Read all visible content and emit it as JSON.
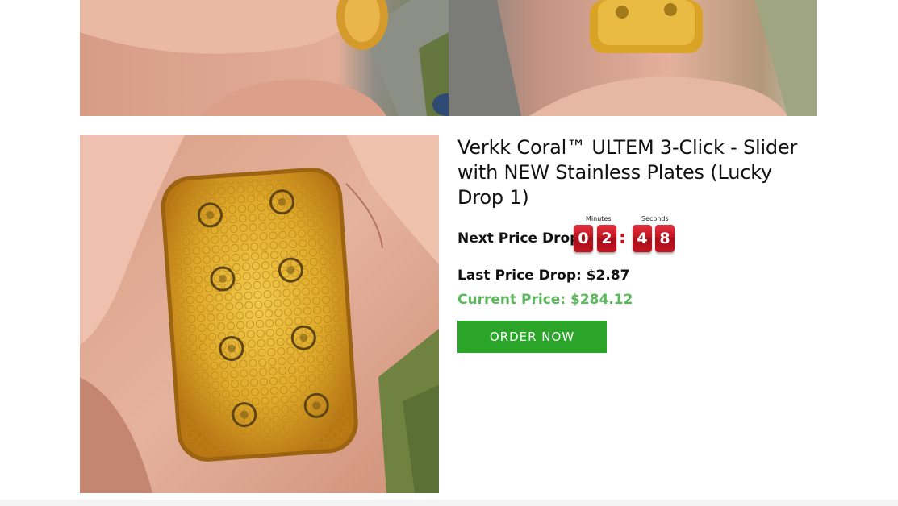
{
  "product": {
    "title": "Verkk Coral™ ULTEM 3-Click - Slider with NEW Stainless Plates (Lucky Drop 1)",
    "next_price_drop_label": "Next Price Drop:",
    "countdown": {
      "minutes_label": "Minutes",
      "seconds_label": "Seconds",
      "minutes_digits": [
        "0",
        "2"
      ],
      "seconds_digits": [
        "4",
        "8"
      ],
      "separator": ":"
    },
    "last_price_drop": "Last Price Drop: $2.87",
    "current_price": "Current Price: $284.12",
    "order_button_label": "ORDER NOW"
  },
  "colors": {
    "current_price": "#5cb85c",
    "order_button": "#2aa52a",
    "countdown_digit": "#c4121f"
  }
}
